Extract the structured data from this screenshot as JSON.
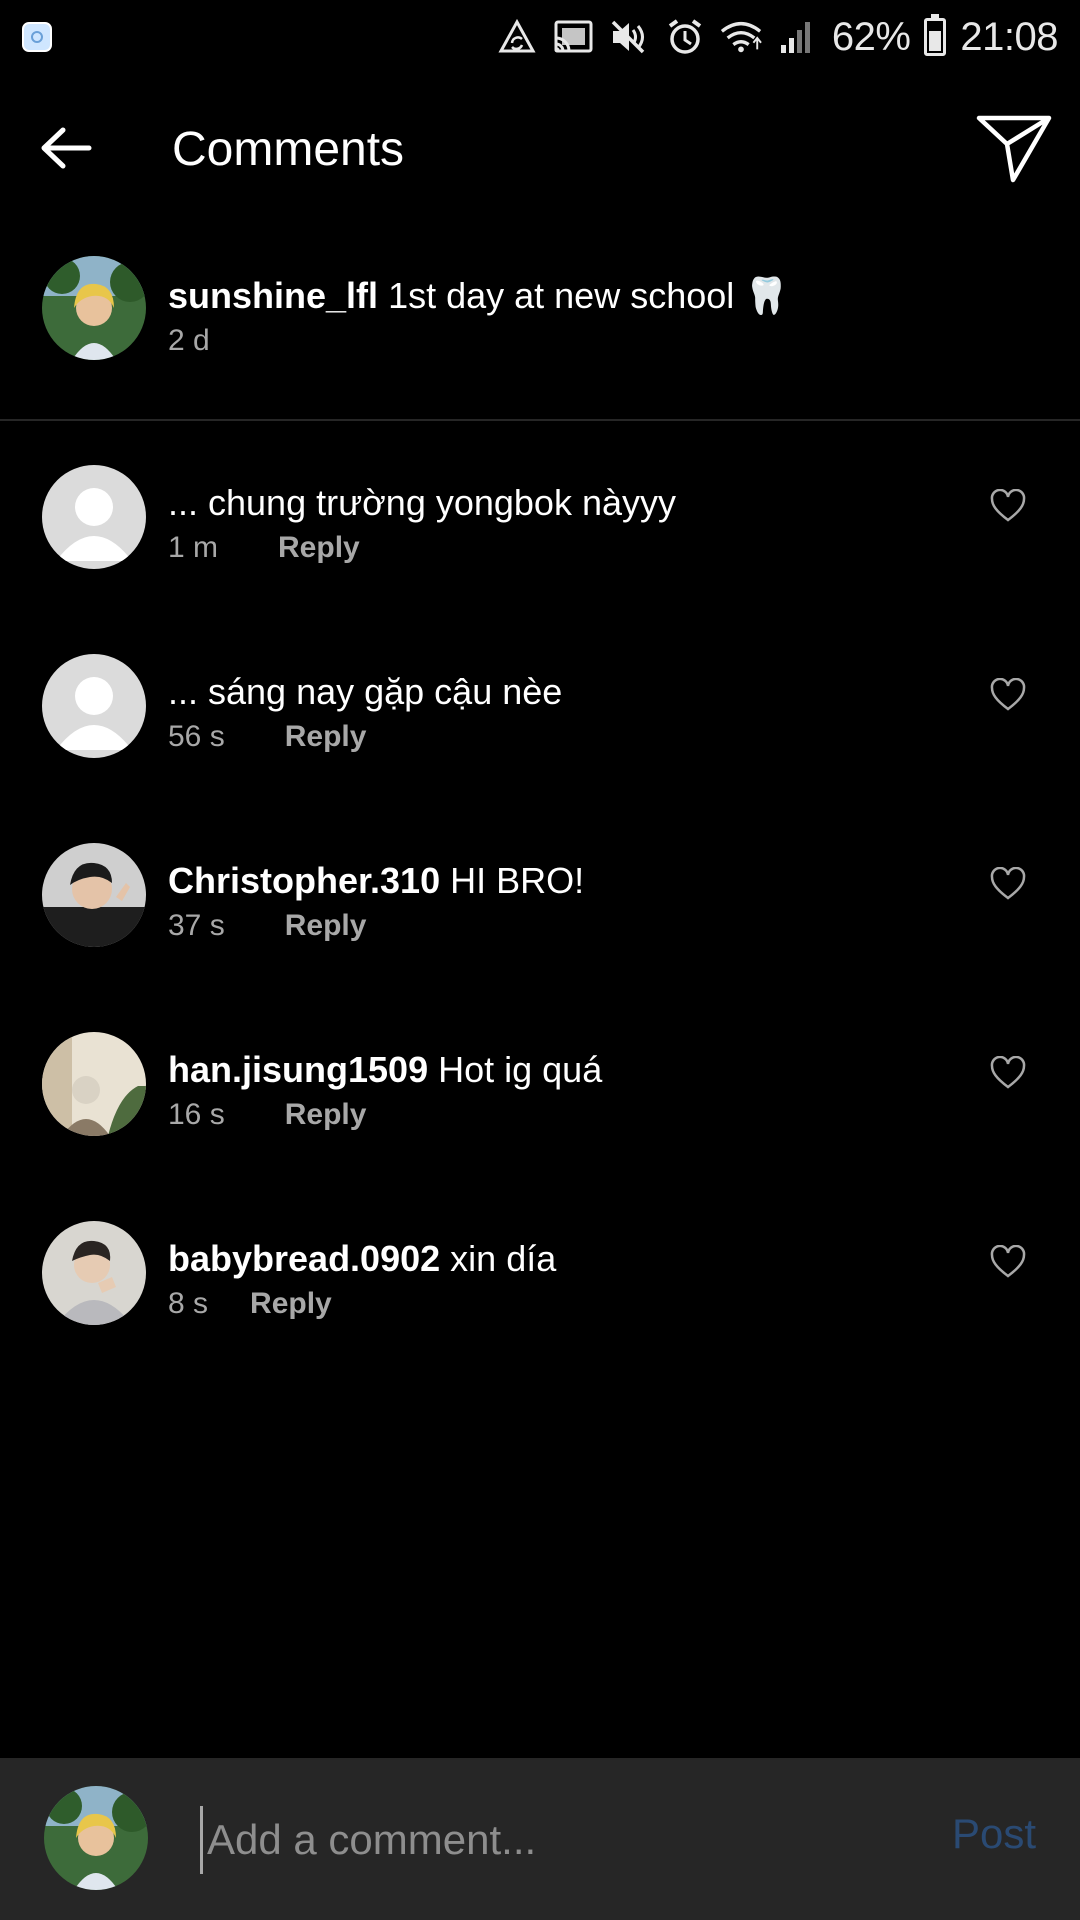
{
  "status_bar": {
    "icons": [
      "app-notification-icon",
      "sync-warning-icon",
      "cast-icon",
      "mute-icon",
      "alarm-icon",
      "wifi-icon",
      "signal-icon",
      "battery-icon"
    ],
    "battery_percent": "62%",
    "battery_level": 0.62,
    "time": "21:08"
  },
  "header": {
    "title": "Comments"
  },
  "caption": {
    "username": "sunshine_lfl",
    "text": "1st day at new school 🦷",
    "time": "2 d"
  },
  "comments": [
    {
      "username": "",
      "text": "... chung trường yongbok nàyyy",
      "time": "1 m",
      "reply_label": "Reply"
    },
    {
      "username": "",
      "text": "... sáng nay gặp cậu nèe",
      "time": "56 s",
      "reply_label": "Reply"
    },
    {
      "username": "Christopher.310",
      "text": "HI BRO!",
      "time": "37 s",
      "reply_label": "Reply"
    },
    {
      "username": "han.jisung1509",
      "text": "Hot ig quá",
      "time": "16 s",
      "reply_label": "Reply"
    },
    {
      "username": "babybread.0902",
      "text": "xin día",
      "time": "8 s",
      "reply_label": "Reply"
    }
  ],
  "composer": {
    "placeholder": "Add a comment...",
    "post_label": "Post"
  },
  "colors": {
    "background": "#000000",
    "composer_bg": "#262626",
    "secondary_text": "#a8a8a8",
    "post_disabled": "#2a4a73"
  }
}
